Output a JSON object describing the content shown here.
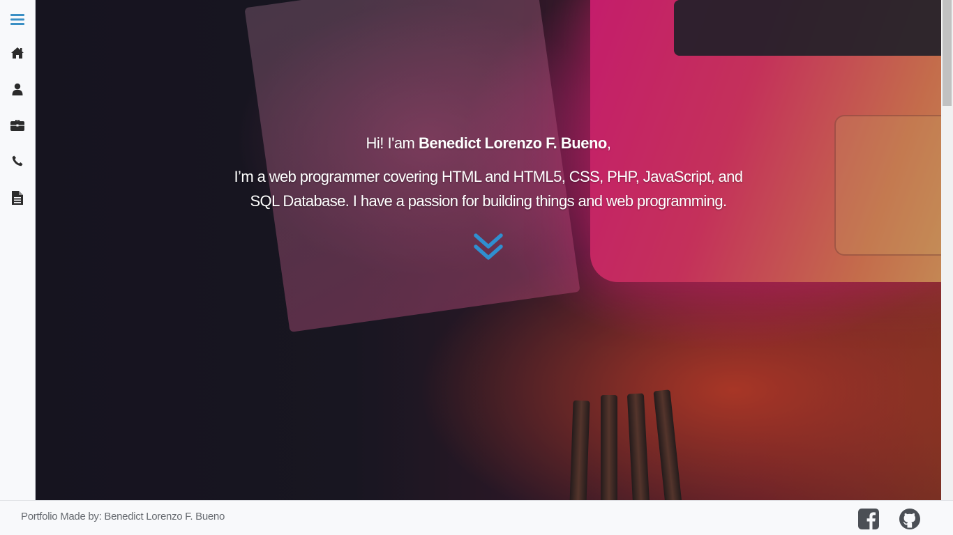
{
  "sidebar": {
    "items": [
      {
        "icon": "menu-icon",
        "color": "#3a8fc4"
      },
      {
        "icon": "home-icon"
      },
      {
        "icon": "user-icon"
      },
      {
        "icon": "briefcase-icon"
      },
      {
        "icon": "phone-icon"
      },
      {
        "icon": "document-icon"
      }
    ]
  },
  "hero": {
    "greeting_prefix": "Hi! I'am ",
    "name": "Benedict Lorenzo F. Bueno",
    "greeting_suffix": ",",
    "intro": "I’m a web programmer covering HTML and HTML5, CSS, PHP, JavaScript, and SQL Database. I have a passion for building things and web programming.",
    "scroll_icon": "chevron-double-down-icon",
    "accent_color": "#2f8fd0"
  },
  "footer": {
    "credit": "Portfolio Made by: Benedict Lorenzo F. Bueno",
    "social": [
      {
        "icon": "facebook-icon"
      },
      {
        "icon": "github-icon"
      }
    ]
  }
}
